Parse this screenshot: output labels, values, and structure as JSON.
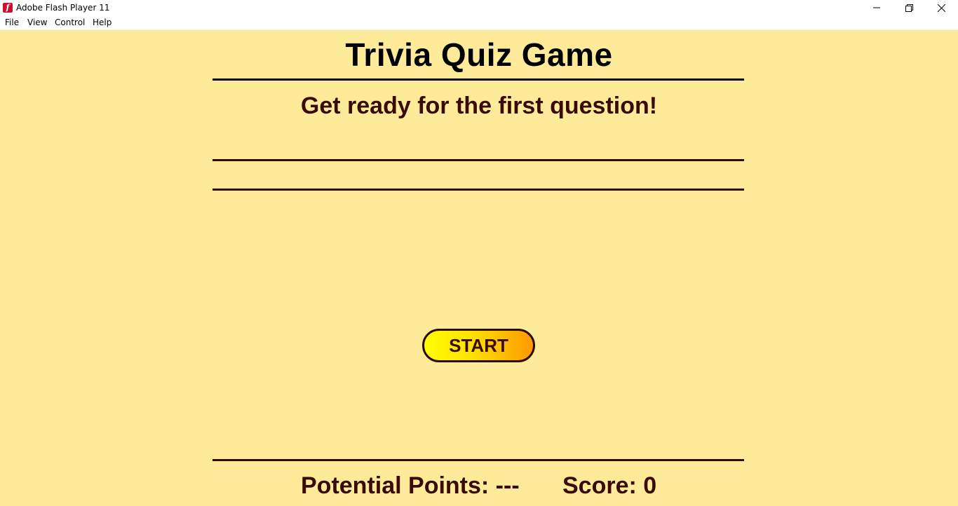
{
  "window": {
    "title": "Adobe Flash Player 11",
    "icon": "flash-icon"
  },
  "menu": {
    "file": "File",
    "view": "View",
    "control": "Control",
    "help": "Help"
  },
  "game": {
    "title": "Trivia Quiz Game",
    "message": "Get ready for the first question!",
    "start_label": "START",
    "potential_points": "Potential Points: ---",
    "score": "Score: 0"
  },
  "colors": {
    "background": "#fdeb9a",
    "text": "#3a0a06",
    "button_gradient_start": "#ffff00",
    "button_gradient_end": "#ff9900"
  }
}
